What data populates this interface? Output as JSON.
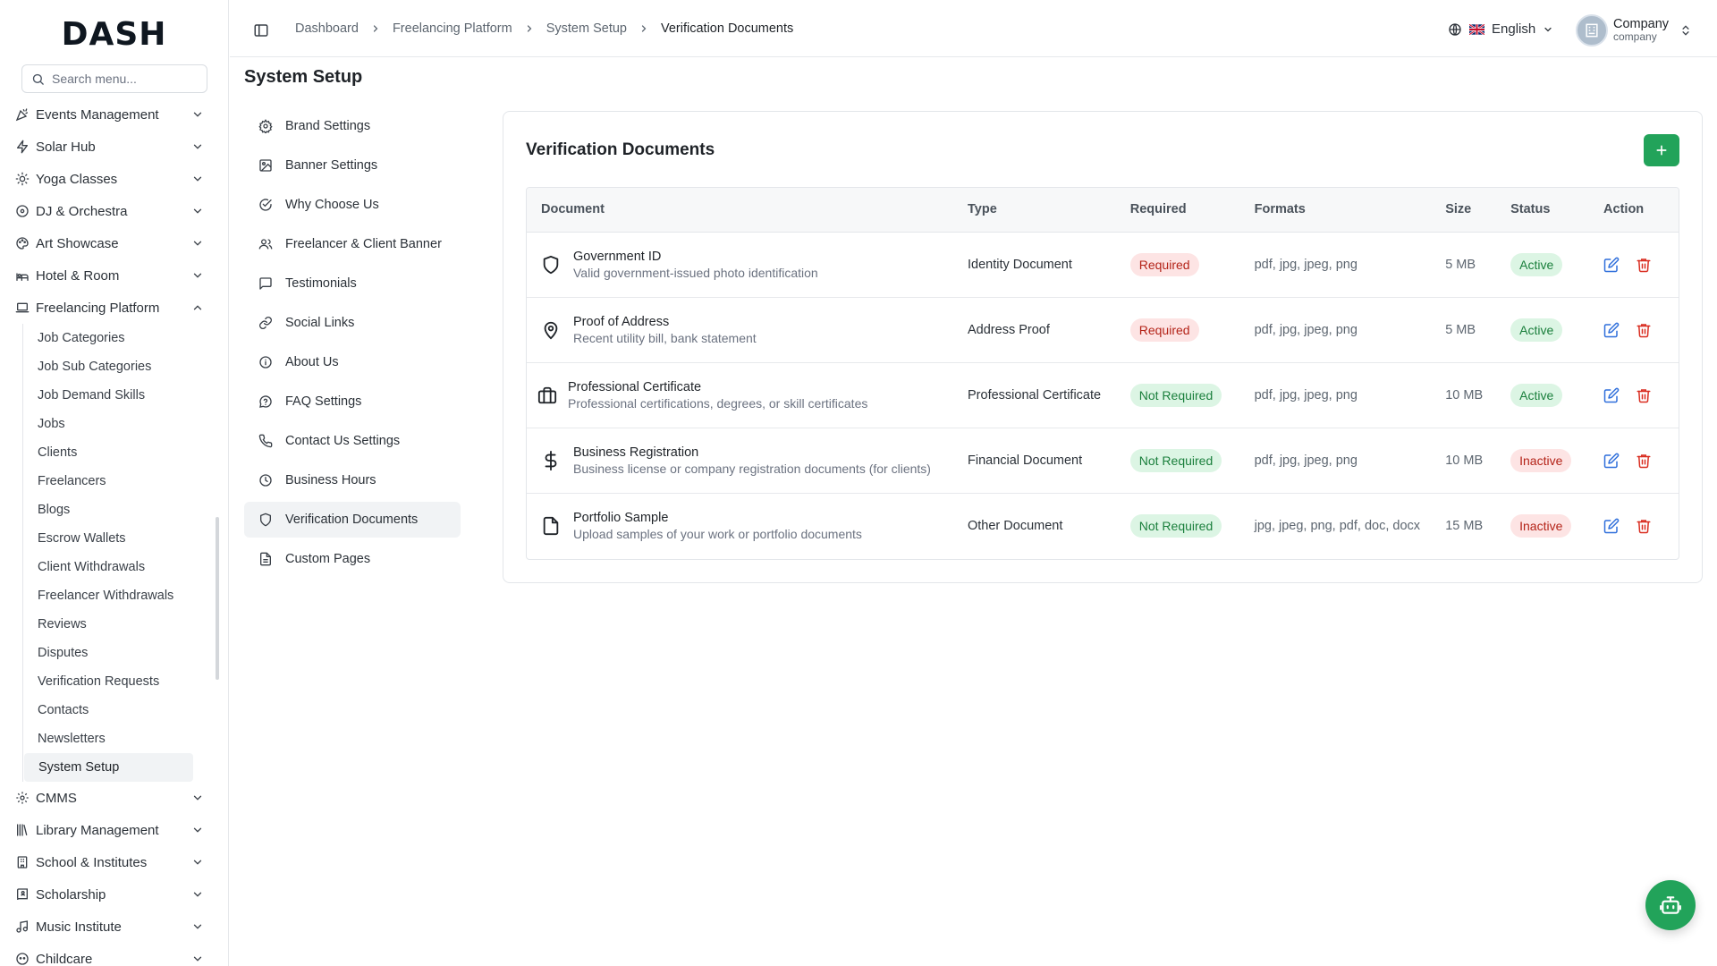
{
  "app": {
    "logo": "DASH"
  },
  "sidebar": {
    "search_placeholder": "Search menu...",
    "items": [
      {
        "label": "Events Management",
        "icon": "party-icon"
      },
      {
        "label": "Solar Hub",
        "icon": "bolt-icon"
      },
      {
        "label": "Yoga Classes",
        "icon": "sun-icon"
      },
      {
        "label": "DJ & Orchestra",
        "icon": "disc-icon"
      },
      {
        "label": "Art Showcase",
        "icon": "palette-icon"
      },
      {
        "label": "Hotel & Room",
        "icon": "hotel-icon"
      },
      {
        "label": "Freelancing Platform",
        "icon": "laptop-icon"
      }
    ],
    "freelancing_sub": [
      "Job Categories",
      "Job Sub Categories",
      "Job Demand Skills",
      "Jobs",
      "Clients",
      "Freelancers",
      "Blogs",
      "Escrow Wallets",
      "Client Withdrawals",
      "Freelancer Withdrawals",
      "Reviews",
      "Disputes",
      "Verification Requests",
      "Contacts",
      "Newsletters",
      "System Setup"
    ],
    "items_after": [
      {
        "label": "CMMS",
        "icon": "cog-icon"
      },
      {
        "label": "Library Management",
        "icon": "library-icon"
      },
      {
        "label": "School & Institutes",
        "icon": "school-icon"
      },
      {
        "label": "Scholarship",
        "icon": "book-user-icon"
      },
      {
        "label": "Music Institute",
        "icon": "music-icon"
      },
      {
        "label": "Childcare",
        "icon": "child-icon"
      }
    ]
  },
  "topbar": {
    "breadcrumb": [
      "Dashboard",
      "Freelancing Platform",
      "System Setup",
      "Verification Documents"
    ],
    "language": "English",
    "company_name": "Company",
    "company_role": "company"
  },
  "page": {
    "title": "System Setup",
    "settings_nav": [
      "Brand Settings",
      "Banner Settings",
      "Why Choose Us",
      "Freelancer & Client Banner",
      "Testimonials",
      "Social Links",
      "About Us",
      "FAQ Settings",
      "Contact Us Settings",
      "Business Hours",
      "Verification Documents",
      "Custom Pages"
    ],
    "active_setting": "Verification Documents"
  },
  "card": {
    "title": "Verification Documents",
    "columns": [
      "Document",
      "Type",
      "Required",
      "Formats",
      "Size",
      "Status",
      "Action"
    ],
    "rows": [
      {
        "name": "Government ID",
        "desc": "Valid government-issued photo identification",
        "icon": "shield-icon",
        "type": "Identity Document",
        "required": "Required",
        "formats": "pdf, jpg, jpeg, png",
        "size": "5 MB",
        "status": "Active"
      },
      {
        "name": "Proof of Address",
        "desc": "Recent utility bill, bank statement",
        "icon": "map-pin-icon",
        "type": "Address Proof",
        "required": "Required",
        "formats": "pdf, jpg, jpeg, png",
        "size": "5 MB",
        "status": "Active"
      },
      {
        "name": "Professional Certificate",
        "desc": "Professional certifications, degrees, or skill certificates",
        "icon": "briefcase-icon",
        "type": "Professional Certificate",
        "required": "Not Required",
        "formats": "pdf, jpg, jpeg, png",
        "size": "10 MB",
        "status": "Active"
      },
      {
        "name": "Business Registration",
        "desc": "Business license or company registration documents (for clients)",
        "icon": "dollar-icon",
        "type": "Financial Document",
        "required": "Not Required",
        "formats": "pdf, jpg, jpeg, png",
        "size": "10 MB",
        "status": "Inactive"
      },
      {
        "name": "Portfolio Sample",
        "desc": "Upload samples of your work or portfolio documents",
        "icon": "file-icon",
        "type": "Other Document",
        "required": "Not Required",
        "formats": "jpg, jpeg, png, pdf, doc, docx",
        "size": "15 MB",
        "status": "Inactive"
      }
    ]
  },
  "colors": {
    "accent": "#22a35a",
    "danger": "#d92d20",
    "edit": "#2f6fdb",
    "badge_red_bg": "#fde4e4",
    "badge_green_bg": "#dcf5e4"
  }
}
